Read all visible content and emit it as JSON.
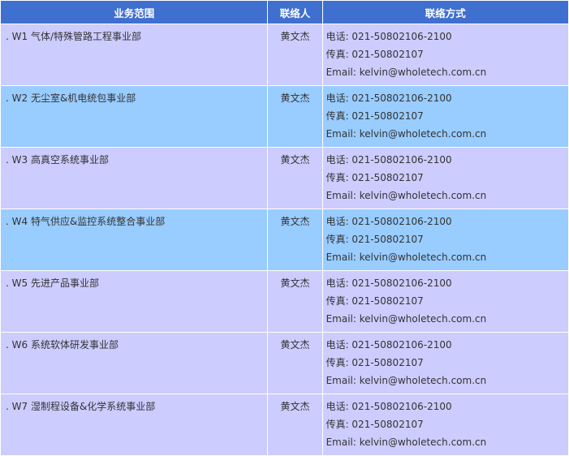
{
  "headers": {
    "scope": "业务范围",
    "person": "联络人",
    "contact": "联络方式"
  },
  "rows": [
    {
      "scope": ". W1 气体/特殊管路工程事业部",
      "person": "黄文杰",
      "phone": "电话: 021-50802106-2100",
      "fax": "传真: 021-50802107",
      "email": "Email: kelvin@wholetech.com.cn"
    },
    {
      "scope": ". W2 无尘室&机电统包事业部",
      "person": "黄文杰",
      "phone": "电话: 021-50802106-2100",
      "fax": "传真: 021-50802107",
      "email": "Email: kelvin@wholetech.com.cn"
    },
    {
      "scope": ". W3 高真空系统事业部",
      "person": "黄文杰",
      "phone": "电话: 021-50802106-2100",
      "fax": "传真: 021-50802107",
      "email": "Email: kelvin@wholetech.com.cn"
    },
    {
      "scope": ". W4 特气供应&监控系统整合事业部",
      "person": "黄文杰",
      "phone": "电话: 021-50802106-2100",
      "fax": "传真: 021-50802107",
      "email": "Email: kelvin@wholetech.com.cn"
    },
    {
      "scope": ". W5 先进产品事业部",
      "person": "黄文杰",
      "phone": "电话: 021-50802106-2100",
      "fax": "传真: 021-50802107",
      "email": "Email: kelvin@wholetech.com.cn"
    },
    {
      "scope": ". W6 系统软体研发事业部",
      "person": "黄文杰",
      "phone": "电话: 021-50802106-2100",
      "fax": "传真: 021-50802107",
      "email": "Email: kelvin@wholetech.com.cn"
    },
    {
      "scope": ". W7 湿制程设备&化学系统事业部",
      "person": "黄文杰",
      "phone": "电话: 021-50802106-2100",
      "fax": "传真: 021-50802107",
      "email": "Email: kelvin@wholetech.com.cn"
    }
  ],
  "colors": {
    "header_bg": "#3f6fcf",
    "row_odd_bg": "#ccccff",
    "row_even_bg": "#99ccff"
  }
}
